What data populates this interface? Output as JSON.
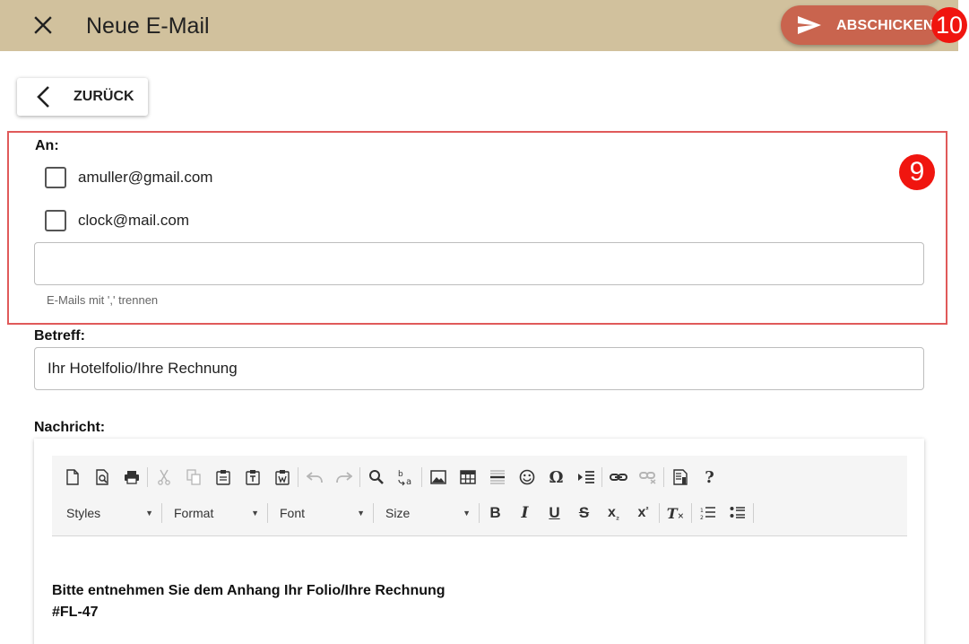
{
  "header": {
    "title": "Neue E-Mail",
    "send_label": "ABSCHICKEN",
    "accent_color": "#d1c19d",
    "send_color": "#c9644e"
  },
  "annotations": {
    "badge_send": "10",
    "badge_recipients": "9"
  },
  "back_label": "ZURÜCK",
  "recipients": {
    "label": "An:",
    "items": [
      {
        "email": "amuller@gmail.com",
        "checked": false
      },
      {
        "email": "clock@mail.com",
        "checked": false
      }
    ],
    "input_value": "",
    "hint": "E-Mails mit ',' trennen"
  },
  "subject": {
    "label": "Betreff:",
    "value": "Ihr Hotelfolio/Ihre Rechnung"
  },
  "message": {
    "label": "Nachricht:",
    "toolbar": {
      "combos": [
        "Styles",
        "Format",
        "Font",
        "Size"
      ],
      "icons_row1": [
        "new-page-icon",
        "preview-icon",
        "print-icon",
        "cut-icon",
        "copy-icon",
        "paste-icon",
        "paste-text-icon",
        "paste-word-icon",
        "undo-icon",
        "redo-icon",
        "find-icon",
        "replace-icon",
        "image-icon",
        "table-icon",
        "horizontal-line-icon",
        "smiley-icon",
        "special-char-icon",
        "indent-icon",
        "link-icon",
        "unlink-icon",
        "source-icon",
        "help-icon"
      ],
      "icons_row2": [
        "bold-icon",
        "italic-icon",
        "underline-icon",
        "strike-icon",
        "subscript-icon",
        "superscript-icon",
        "remove-format-icon",
        "numbered-list-icon",
        "bulleted-list-icon"
      ]
    },
    "content_line1": "Bitte entnehmen Sie dem Anhang Ihr Folio/Ihre Rechnung",
    "content_line2": "#FL-47"
  }
}
